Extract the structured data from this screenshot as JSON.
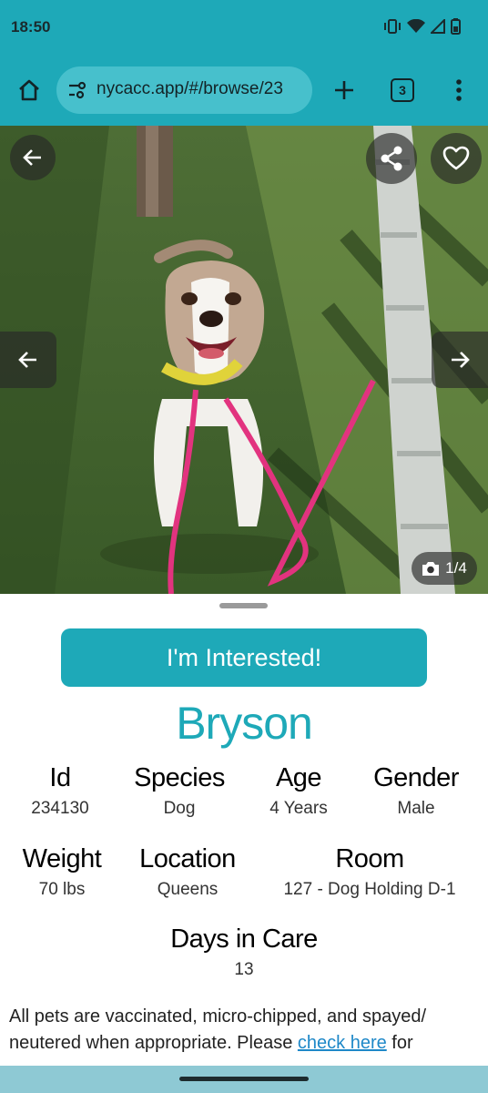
{
  "status_bar": {
    "time": "18:50"
  },
  "browser": {
    "url": "nycacc.app/#/browse/23",
    "tab_count": "3"
  },
  "gallery": {
    "counter": "1/4"
  },
  "cta": {
    "label": "I'm Interested!"
  },
  "pet": {
    "name": "Bryson",
    "facts_row1": [
      {
        "key": "Id",
        "value": "234130"
      },
      {
        "key": "Species",
        "value": "Dog"
      },
      {
        "key": "Age",
        "value": "4 Years"
      },
      {
        "key": "Gender",
        "value": "Male"
      }
    ],
    "facts_row2": [
      {
        "key": "Weight",
        "value": "70 lbs"
      },
      {
        "key": "Location",
        "value": "Queens"
      },
      {
        "key": "Room",
        "value": "127 - Dog Holding D-1"
      }
    ],
    "days_in_care": {
      "key": "Days in Care",
      "value": "13"
    }
  },
  "description": {
    "text_before_link": "All pets are vaccinated, micro-chipped, and spayed/ neutered when appropriate. Please ",
    "link_text": "check here",
    "text_after_link": " for"
  },
  "colors": {
    "accent": "#1ea9b8",
    "link": "#1e88c8"
  },
  "icons": [
    "home-icon",
    "site-settings-icon",
    "plus-icon",
    "tabs-icon",
    "more-vert-icon",
    "back-arrow-icon",
    "share-icon",
    "heart-icon",
    "prev-arrow-icon",
    "next-arrow-icon",
    "camera-icon"
  ]
}
